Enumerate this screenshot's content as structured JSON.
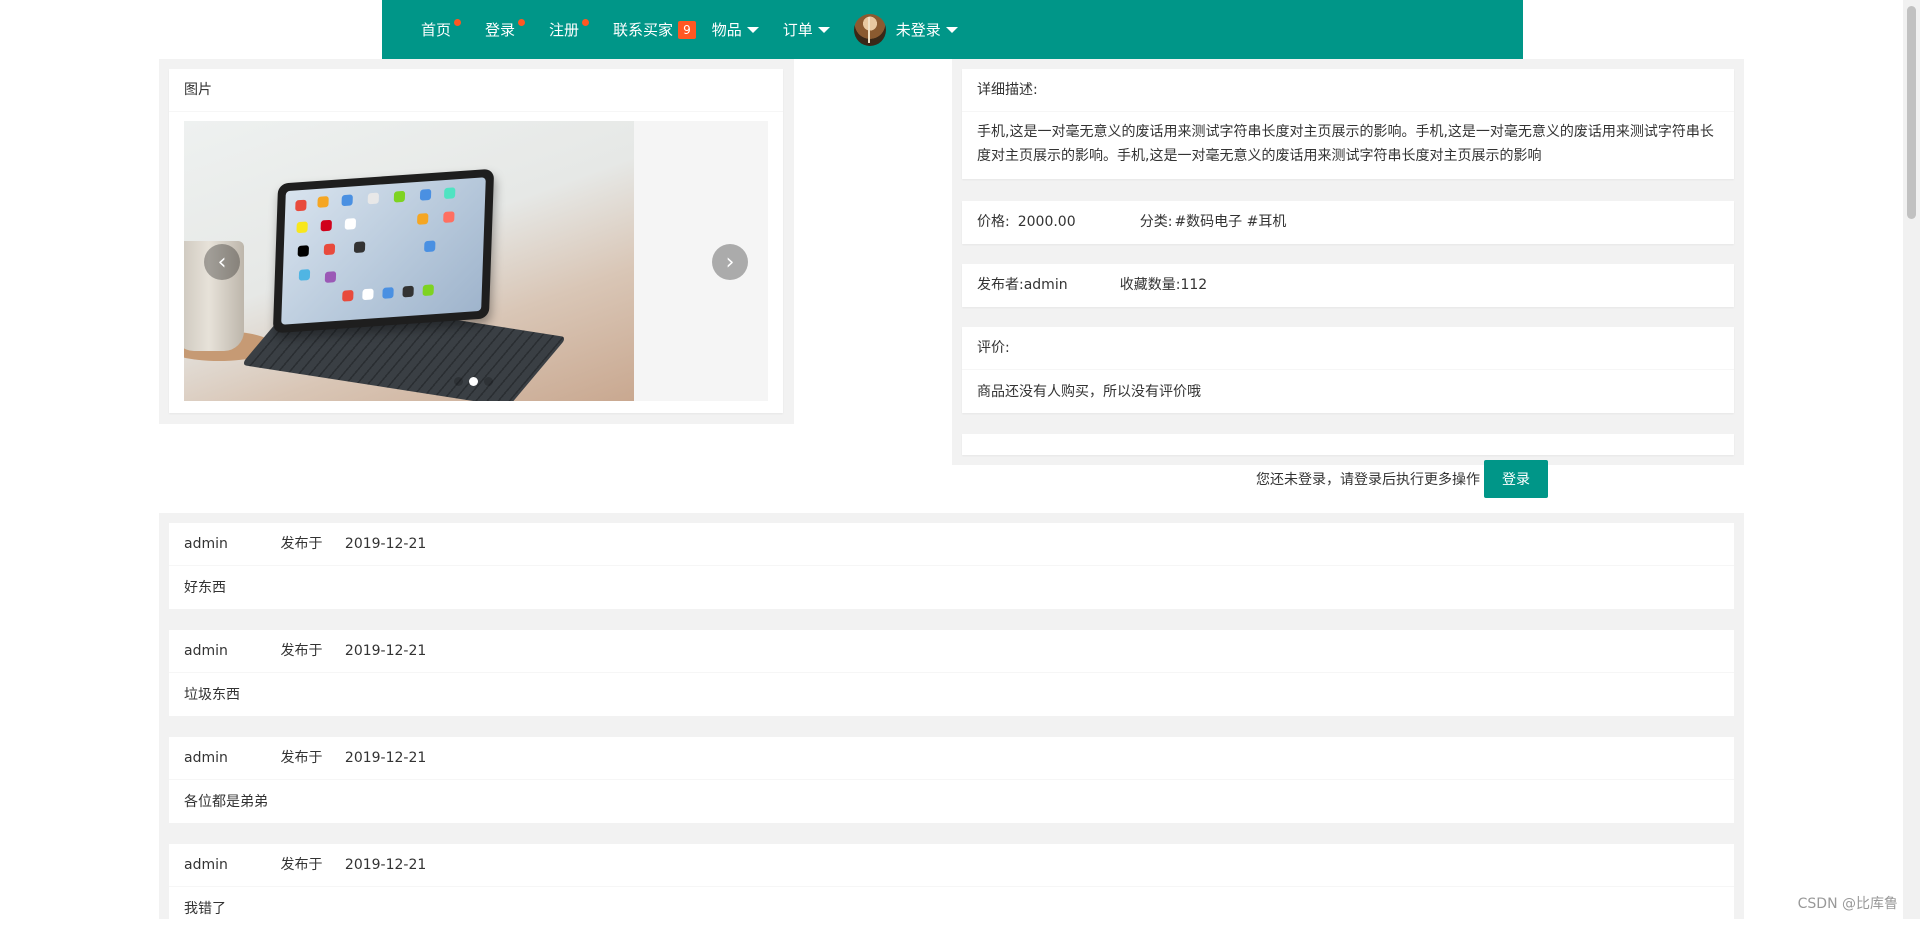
{
  "nav": {
    "items": [
      {
        "label": "首页",
        "dot": true
      },
      {
        "label": "登录",
        "dot": true
      },
      {
        "label": "注册",
        "dot": true
      },
      {
        "label": "联系买家",
        "badge": "9"
      },
      {
        "label": "物品",
        "caret": true
      },
      {
        "label": "订单",
        "caret": true
      }
    ],
    "user_label": "未登录",
    "accent_color": "#009688",
    "dot_color": "#ff5722"
  },
  "image_card": {
    "title": "图片",
    "carousel": {
      "slide_count": 3,
      "active_index": 1,
      "prev_icon": "‹",
      "next_icon": "›"
    }
  },
  "detail": {
    "title": "详细描述:",
    "text": "手机,这是一对毫无意义的废话用来测试字符串长度对主页展示的影响。手机,这是一对毫无意义的废话用来测试字符串长度对主页展示的影响。手机,这是一对毫无意义的废话用来测试字符串长度对主页展示的影响"
  },
  "price": {
    "label": "价格:",
    "value": "2000.00",
    "category_label": "分类:",
    "category_value": "#数码电子 #耳机"
  },
  "publisher": {
    "label": "发布者:",
    "value": "admin",
    "favorites_label": "收藏数量:",
    "favorites_value": "112"
  },
  "review": {
    "title": "评价:",
    "text": "商品还没有人购买，所以没有评价哦"
  },
  "login_prompt": {
    "text": "您还未登录，请登录后执行更多操作",
    "button": "登录"
  },
  "comments": [
    {
      "user": "admin",
      "posted_label": "发布于",
      "date": "2019-12-21",
      "content": "好东西"
    },
    {
      "user": "admin",
      "posted_label": "发布于",
      "date": "2019-12-21",
      "content": "垃圾东西"
    },
    {
      "user": "admin",
      "posted_label": "发布于",
      "date": "2019-12-21",
      "content": "各位都是弟弟"
    },
    {
      "user": "admin",
      "posted_label": "发布于",
      "date": "2019-12-21",
      "content": "我错了"
    }
  ],
  "watermark": "CSDN @比库鲁"
}
